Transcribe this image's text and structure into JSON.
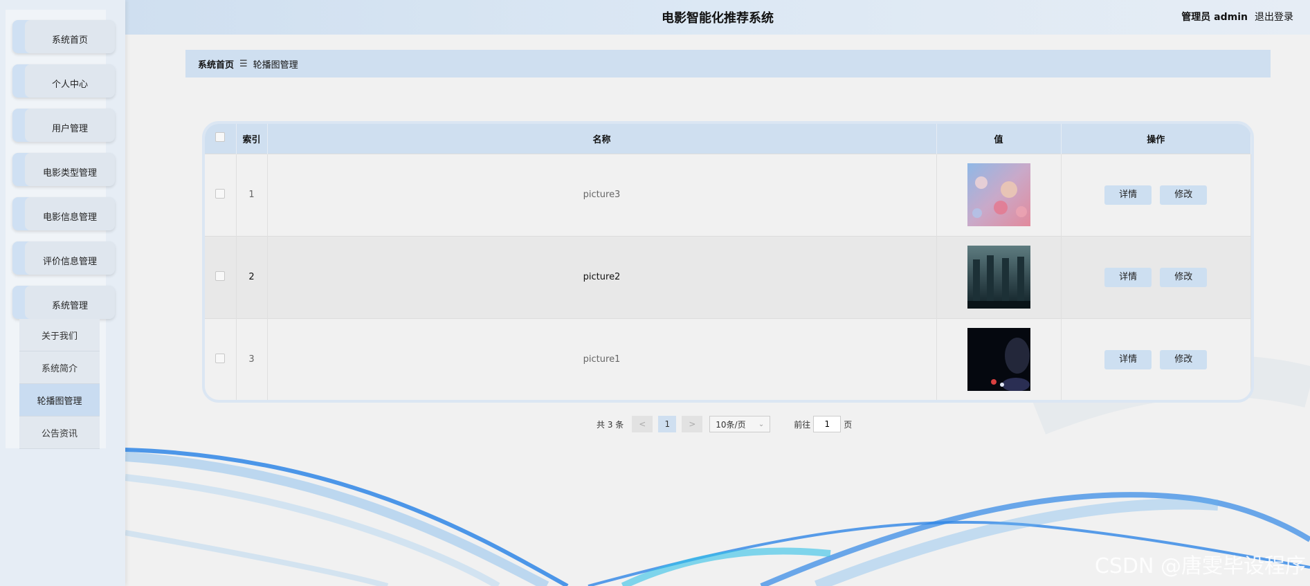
{
  "header": {
    "title": "电影智能化推荐系统",
    "user": "管理员 admin",
    "logout": "退出登录"
  },
  "sidebar": {
    "items": [
      {
        "label": "系统首页"
      },
      {
        "label": "个人中心"
      },
      {
        "label": "用户管理"
      },
      {
        "label": "电影类型管理"
      },
      {
        "label": "电影信息管理"
      },
      {
        "label": "评价信息管理"
      },
      {
        "label": "系统管理"
      }
    ],
    "submenu": [
      {
        "label": "关于我们"
      },
      {
        "label": "系统简介"
      },
      {
        "label": "轮播图管理",
        "active": true
      },
      {
        "label": "公告资讯"
      }
    ]
  },
  "breadcrumb": {
    "home": "系统首页",
    "sep": "☰",
    "current": "轮播图管理"
  },
  "table": {
    "columns": [
      "",
      "索引",
      "名称",
      "值",
      "操作"
    ],
    "rows": [
      {
        "index": "1",
        "name": "picture3",
        "image": "photo-people-pink"
      },
      {
        "index": "2",
        "name": "picture2",
        "image": "photo-building-dark"
      },
      {
        "index": "3",
        "name": "picture1",
        "image": "photo-dark-figure"
      }
    ],
    "detail_label": "详情",
    "edit_label": "修改"
  },
  "pagination": {
    "total": "共 3 条",
    "prev": "<",
    "current_page": "1",
    "next": ">",
    "page_size": "10条/页",
    "goto_prefix": "前往",
    "goto_value": "1",
    "goto_suffix": "页"
  },
  "watermark": "CSDN @唐雯毕设程序",
  "colors": {
    "accent": "#cfdff0",
    "wave": "#2f86e6"
  }
}
